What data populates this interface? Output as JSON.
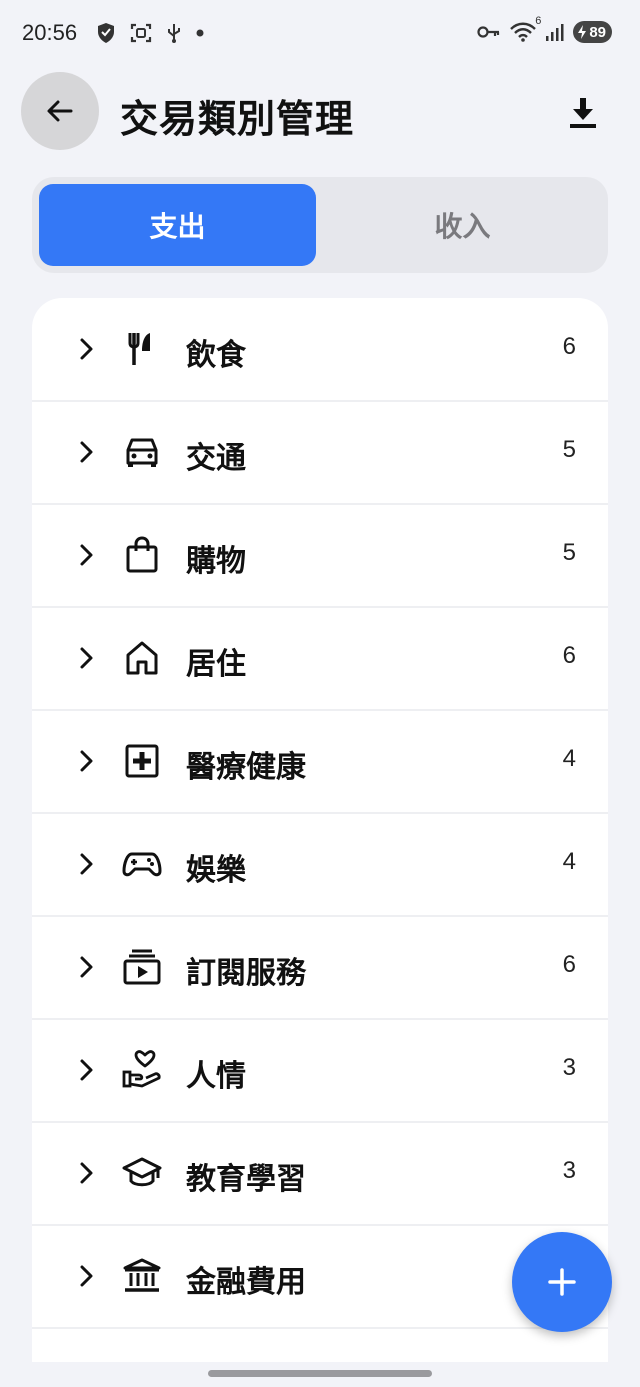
{
  "status_bar": {
    "time": "20:56",
    "battery": "89",
    "wifi_badge": "6"
  },
  "header": {
    "title": "交易類別管理"
  },
  "tabs": [
    {
      "label": "支出",
      "active": true
    },
    {
      "label": "收入",
      "active": false
    }
  ],
  "categories": [
    {
      "name": "飲食",
      "count": "6",
      "icon": "utensils-icon"
    },
    {
      "name": "交通",
      "count": "5",
      "icon": "car-icon"
    },
    {
      "name": "購物",
      "count": "5",
      "icon": "shopping-bag-icon"
    },
    {
      "name": "居住",
      "count": "6",
      "icon": "home-icon"
    },
    {
      "name": "醫療健康",
      "count": "4",
      "icon": "medical-cross-icon"
    },
    {
      "name": "娛樂",
      "count": "4",
      "icon": "gamepad-icon"
    },
    {
      "name": "訂閱服務",
      "count": "6",
      "icon": "subscription-icon"
    },
    {
      "name": "人情",
      "count": "3",
      "icon": "hand-heart-icon"
    },
    {
      "name": "教育學習",
      "count": "3",
      "icon": "graduation-cap-icon"
    },
    {
      "name": "金融費用",
      "count": "",
      "icon": "bank-icon"
    }
  ],
  "colors": {
    "accent": "#3478f6",
    "background": "#f2f3f8",
    "card": "#ffffff"
  }
}
